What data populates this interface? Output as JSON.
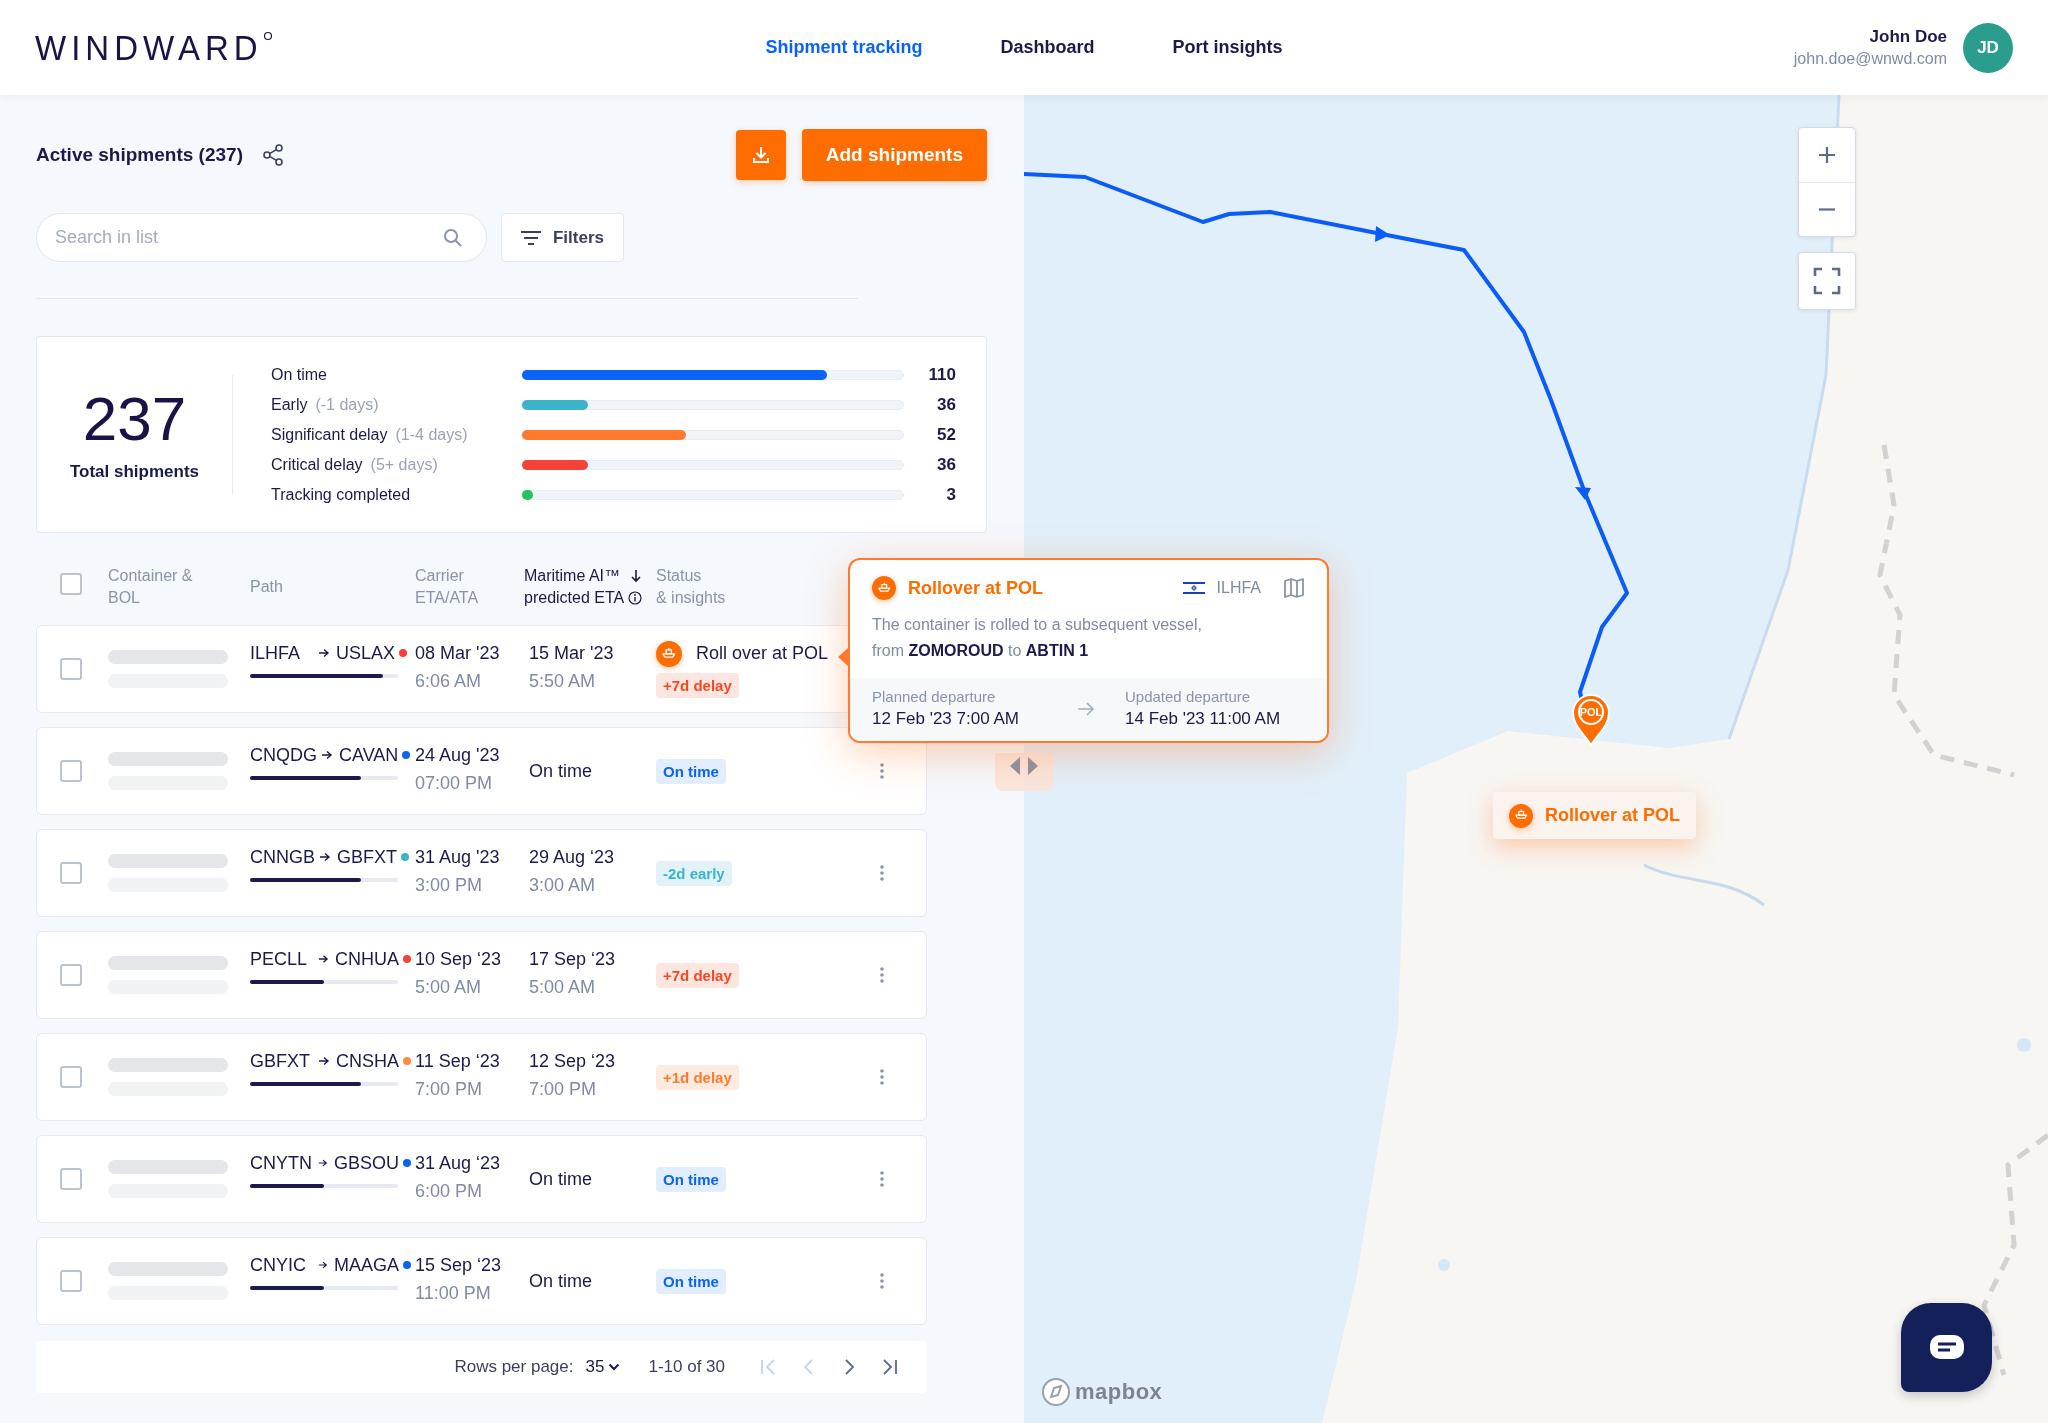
{
  "header": {
    "logo": "WINDWARD",
    "nav": [
      {
        "label": "Shipment tracking",
        "selected": true
      },
      {
        "label": "Dashboard",
        "selected": false
      },
      {
        "label": "Port insights",
        "selected": false
      }
    ],
    "user": {
      "name": "John Doe",
      "email": "john.doe@wnwd.com",
      "initials": "JD"
    }
  },
  "panel": {
    "title": "Active shipments (237)",
    "add_button": "Add shipments",
    "search": {
      "placeholder": "Search in list"
    },
    "filters": "Filters"
  },
  "summary": {
    "total": "237",
    "total_label": "Total shipments",
    "categories": [
      {
        "label": "On time",
        "count": "110",
        "level": 0.8,
        "color": "#0b63f6"
      },
      {
        "label": "Early",
        "note": "(-1 days)",
        "count": "36",
        "level": 0.174,
        "color": "#3ab4c9"
      },
      {
        "label": "Significant delay",
        "note": "(1-4 days)",
        "count": "52",
        "level": 0.43,
        "color": "#ff7a2f"
      },
      {
        "label": "Critical delay",
        "note": "(5+ days)",
        "count": "36",
        "level": 0.174,
        "color": "#f44336"
      },
      {
        "label": "Tracking completed",
        "count": "3",
        "level": 0.03,
        "color": "#22c55e"
      }
    ]
  },
  "table": {
    "select_all": {
      "checked": false
    },
    "columns": [
      {
        "lines": [
          "Container &",
          "BOL"
        ],
        "sorted": false
      },
      {
        "lines": [
          "Path"
        ],
        "sorted": false
      },
      {
        "lines": [
          "Carrier",
          "ETA/ATA"
        ],
        "sorted": false
      },
      {
        "lines": [
          "Maritime AI™",
          "predicted ETA"
        ],
        "sorted": true
      },
      {
        "lines": [
          "Status",
          "& insights"
        ],
        "sorted": false
      }
    ],
    "rows": [
      {
        "checked": false,
        "from": "ILHFA",
        "to": "USLAX",
        "color": "#f44336",
        "level": 0.9,
        "carrier_date": "08 Mar '23",
        "carrier_time": "6:06 AM",
        "predicted_date": "15 Mar '23",
        "predicted_time": "5:50 AM",
        "insight": "Roll over at POL",
        "badge": {
          "kind": "delay",
          "label": "+7d delay"
        },
        "menu": false
      },
      {
        "checked": false,
        "from": "CNQDG",
        "to": "CAVAN",
        "color": "#0b63f6",
        "level": 0.75,
        "carrier_date": "24 Aug '23",
        "carrier_time": "07:00 PM",
        "predicted_date": "On time",
        "badge": {
          "kind": "on_time",
          "label": "On time"
        },
        "menu": true
      },
      {
        "checked": false,
        "from": "CNNGB",
        "to": "GBFXT",
        "color": "#3ab4c9",
        "level": 0.75,
        "carrier_date": "31 Aug '23",
        "carrier_time": "3:00 PM",
        "predicted_date": "29 Aug ‘23",
        "predicted_time": "3:00 AM",
        "badge": {
          "kind": "early",
          "label": "-2d early"
        },
        "menu": true
      },
      {
        "checked": false,
        "from": "PECLL",
        "to": "CNHUA",
        "color": "#f44336",
        "level": 0.5,
        "carrier_date": "10 Sep ‘23",
        "carrier_time": "5:00 AM",
        "predicted_date": "17 Sep ‘23",
        "predicted_time": "5:00 AM",
        "badge": {
          "kind": "delay",
          "label": "+7d delay"
        },
        "menu": true
      },
      {
        "checked": false,
        "from": "GBFXT",
        "to": "CNSHA",
        "color": "#ff8a3d",
        "level": 0.75,
        "carrier_date": "11 Sep ‘23",
        "carrier_time": "7:00 PM",
        "predicted_date": "12 Sep ‘23",
        "predicted_time": "7:00 PM",
        "badge": {
          "kind": "minor_delay",
          "label": "+1d delay"
        },
        "menu": true
      },
      {
        "checked": false,
        "from": "CNYTN",
        "to": "GBSOU",
        "color": "#0b63f6",
        "level": 0.5,
        "carrier_date": "31 Aug ‘23",
        "carrier_time": "6:00 PM",
        "predicted_date": "On time",
        "badge": {
          "kind": "on_time",
          "label": "On time"
        },
        "menu": true
      },
      {
        "checked": false,
        "from": "CNYIC",
        "to": "MAAGA",
        "color": "#0b63f6",
        "level": 0.5,
        "carrier_date": "15 Sep ‘23",
        "carrier_time": "11:00 PM",
        "predicted_date": "On time",
        "badge": {
          "kind": "on_time",
          "label": "On time"
        },
        "menu": true
      }
    ],
    "pagination": {
      "rows_label": "Rows per page:",
      "rows_value": "35",
      "range": "1-10 of 30",
      "buttons": [
        {
          "kind": "first",
          "disabled": true
        },
        {
          "kind": "prev",
          "disabled": true
        },
        {
          "kind": "next",
          "disabled": false
        },
        {
          "kind": "last",
          "disabled": false
        }
      ]
    }
  },
  "popup": {
    "title": "Rollover at POL",
    "port": "ILHFA",
    "description": [
      "The container is rolled to a subsequent vessel,",
      "from **ZOMOROUD** to **ABTIN 1**"
    ],
    "planned": {
      "label": "Planned departure",
      "value": "12 Feb '23 7:00 AM"
    },
    "updated": {
      "label": "Updated departure",
      "value": "14 Feb '23 11:00 AM"
    }
  },
  "map": {
    "pin_label": "POL",
    "marker_label": "Rollover at POL",
    "attribution": "mapbox"
  }
}
